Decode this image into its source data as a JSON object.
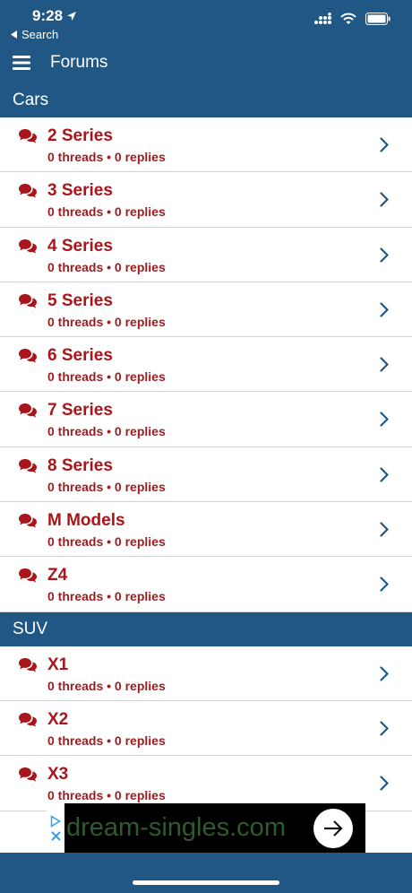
{
  "status": {
    "time": "9:28",
    "back_label": "Search"
  },
  "nav": {
    "title": "Forums"
  },
  "sections": {
    "cars": {
      "title": "Cars",
      "items": [
        {
          "name": "2 Series",
          "meta": "0 threads • 0 replies"
        },
        {
          "name": "3 Series",
          "meta": "0 threads • 0 replies"
        },
        {
          "name": "4 Series",
          "meta": "0 threads • 0 replies"
        },
        {
          "name": "5 Series",
          "meta": "0 threads • 0 replies"
        },
        {
          "name": "6 Series",
          "meta": "0 threads • 0 replies"
        },
        {
          "name": "7 Series",
          "meta": "0 threads • 0 replies"
        },
        {
          "name": "8 Series",
          "meta": "0 threads • 0 replies"
        },
        {
          "name": "M Models",
          "meta": "0 threads • 0 replies"
        },
        {
          "name": "Z4",
          "meta": "0 threads • 0 replies"
        }
      ]
    },
    "suv": {
      "title": "SUV",
      "items": [
        {
          "name": "X1",
          "meta": "0 threads • 0 replies"
        },
        {
          "name": "X2",
          "meta": "0 threads • 0 replies"
        },
        {
          "name": "X3",
          "meta": "0 threads • 0 replies"
        }
      ]
    }
  },
  "ad": {
    "text": "dream-singles.com"
  },
  "colors": {
    "header": "#215785",
    "forum_title": "#a8161b",
    "chevron": "#215785"
  }
}
